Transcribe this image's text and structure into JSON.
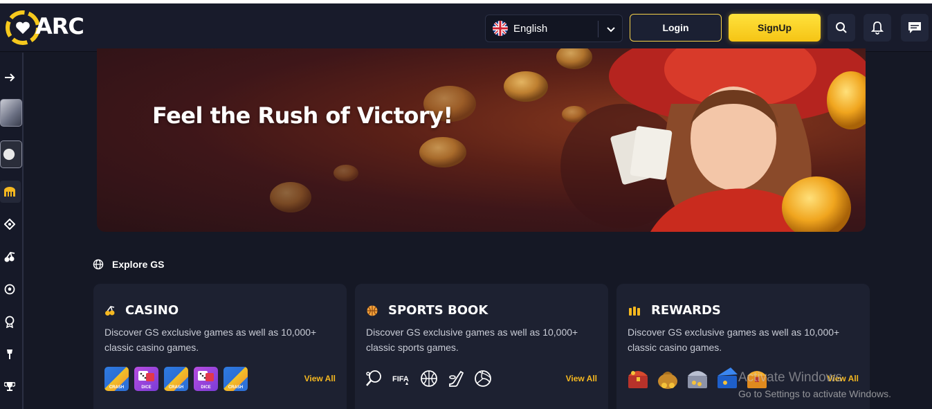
{
  "header": {
    "logo_text": "ARC",
    "language": "English",
    "login_label": "Login",
    "signup_label": "SignUp"
  },
  "banner": {
    "title": "Feel the Rush of Victory!"
  },
  "explore": {
    "title": "Explore GS"
  },
  "cards": [
    {
      "title": "CASINO",
      "description": "Discover GS exclusive games as well as 10,000+ classic casino games.",
      "view_all": "View All",
      "games": [
        "CRASH",
        "DICE",
        "CRASH",
        "DICE",
        "CRASH"
      ]
    },
    {
      "title": "SPORTS BOOK",
      "description": "Discover GS exclusive games as well as 10,000+ classic sports games.",
      "view_all": "View All"
    },
    {
      "title": "REWARDS",
      "description": "Discover GS exclusive games as well as 10,000+ classic casino games.",
      "view_all": "View All"
    }
  ],
  "os_watermark": {
    "line1": "Activate Windows",
    "line2": "Go to Settings to activate Windows."
  },
  "colors": {
    "accent": "#f5c415",
    "background": "#151825",
    "card": "#1d2131",
    "view_all": "#f5b820"
  }
}
